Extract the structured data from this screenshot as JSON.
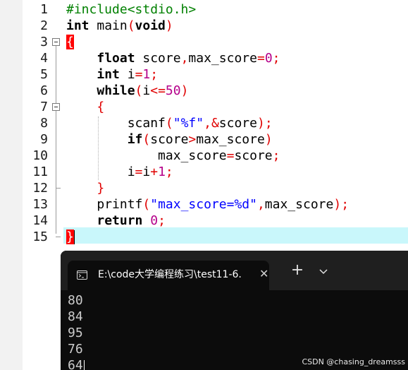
{
  "editor": {
    "lines": [
      {
        "n": "1"
      },
      {
        "n": "2"
      },
      {
        "n": "3"
      },
      {
        "n": "4"
      },
      {
        "n": "5"
      },
      {
        "n": "6"
      },
      {
        "n": "7"
      },
      {
        "n": "8"
      },
      {
        "n": "9"
      },
      {
        "n": "10"
      },
      {
        "n": "11"
      },
      {
        "n": "12"
      },
      {
        "n": "13"
      },
      {
        "n": "14"
      },
      {
        "n": "15"
      }
    ],
    "code": {
      "l1": {
        "directive": "#include<stdio.h>"
      },
      "l2": {
        "kw_int": "int",
        "rest": " main",
        "lparen": "(",
        "kw_void": "void",
        "rparen": ")"
      },
      "l3": {
        "brace": "{"
      },
      "l4": {
        "indent": "    ",
        "kw_float": "float",
        "a": " score",
        "comma": ",",
        "b": "max_score",
        "eq": "=",
        "num": "0",
        "semi": ";"
      },
      "l5": {
        "indent": "    ",
        "kw_int": "int",
        "a": " i",
        "eq": "=",
        "num": "1",
        "semi": ";"
      },
      "l6": {
        "indent": "    ",
        "kw_while": "while",
        "lparen": "(",
        "a": "i",
        "le": "<=",
        "num": "50",
        "rparen": ")"
      },
      "l7": {
        "indent": "    ",
        "brace": "{"
      },
      "l8": {
        "indent": "        ",
        "fn": "scanf",
        "lparen": "(",
        "str": "\"%f\"",
        "comma": ",",
        "amp": "&",
        "a": "score",
        "rparen": ")",
        "semi": ";"
      },
      "l9": {
        "indent": "        ",
        "kw_if": "if",
        "lparen": "(",
        "a": "score",
        "gt": ">",
        "b": "max_score",
        "rparen": ")"
      },
      "l10": {
        "indent": "            ",
        "a": "max_score",
        "eq": "=",
        "b": "score",
        "semi": ";"
      },
      "l11": {
        "indent": "        ",
        "a": "i",
        "eq": "=",
        "b": "i",
        "plus": "+",
        "num": "1",
        "semi": ";"
      },
      "l12": {
        "indent": "    ",
        "brace": "}"
      },
      "l13": {
        "indent": "    ",
        "fn": "printf",
        "lparen": "(",
        "str": "\"max_score=%d\"",
        "comma": ",",
        "a": "max_score",
        "rparen": ")",
        "semi": ";"
      },
      "l14": {
        "indent": "    ",
        "kw_return": "return",
        "sp": " ",
        "num": "0",
        "semi": ";"
      },
      "l15": {
        "brace": "}"
      }
    },
    "colors": {
      "directive": "#008000",
      "number": "#b5008a",
      "operator": "#e00000",
      "string": "#0000ff",
      "current_line": "#c9f7fb",
      "brace_match": "#ff0000"
    }
  },
  "terminal": {
    "tab_title": "E:\\code大学编程练习\\test11-6.",
    "tab_icon": "terminal-icon",
    "close_label": "✕",
    "new_tab_label": "+",
    "dropdown_icon": "chevron-down-icon",
    "output": [
      "80",
      "84",
      "95",
      "76",
      "64"
    ]
  },
  "watermark": "CSDN @chasing_dreamsss"
}
